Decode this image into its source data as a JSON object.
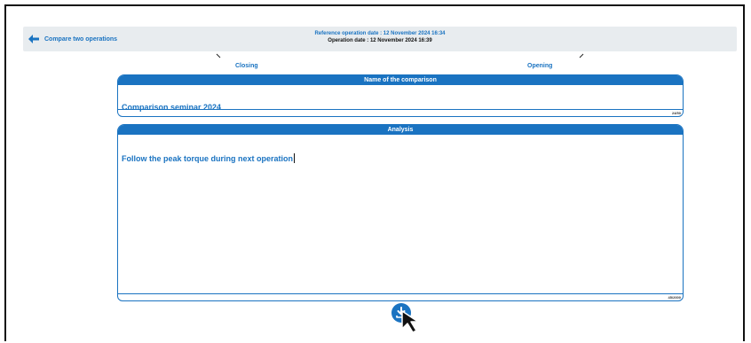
{
  "header": {
    "back_label": "Compare two operations",
    "reference_date": "Reference operation date : 12 November 2024 16:34",
    "operation_date": "Operation date : 12 November 2024 16:39"
  },
  "columns": {
    "left_label": "Closing",
    "right_label": "Opening"
  },
  "name_panel": {
    "title": "Name of the comparison",
    "value": "Comparison seminar 2024",
    "counter": "24/50"
  },
  "analysis_panel": {
    "title": "Analysis",
    "value": "Follow the peak torque during next operation",
    "counter": "45/2000"
  },
  "icons": {
    "back": "arrow-left-icon",
    "download": "download-icon",
    "cursor": "mouse-pointer-icon"
  },
  "colors": {
    "accent": "#1a73c1",
    "header_bg": "#e8ecef"
  }
}
